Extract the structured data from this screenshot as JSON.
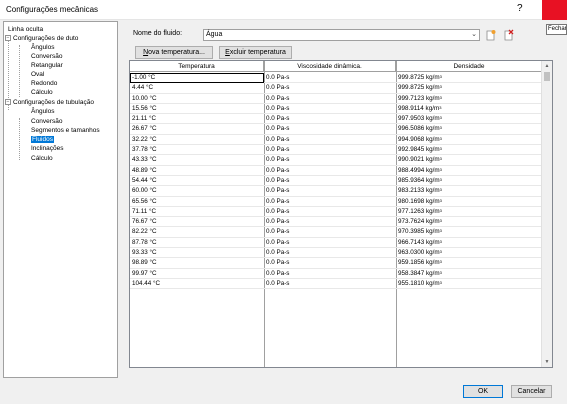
{
  "window": {
    "title": "Configurações mecânicas",
    "help_glyph": "?",
    "close_tooltip": "Fechar"
  },
  "tree": {
    "items": [
      {
        "label": "Linha oculta"
      },
      {
        "label": "Configurações de duto",
        "toggle": "−"
      },
      {
        "label": "Ângulos"
      },
      {
        "label": "Conversão"
      },
      {
        "label": "Retangular"
      },
      {
        "label": "Oval"
      },
      {
        "label": "Redondo"
      },
      {
        "label": "Cálculo"
      },
      {
        "label": "Configurações de tubulação",
        "toggle": "−"
      },
      {
        "label": "Ângulos"
      },
      {
        "label": "Conversão"
      },
      {
        "label": "Segmentos e tamanhos"
      },
      {
        "label": "Fluidos",
        "selected": true
      },
      {
        "label": "Inclinações"
      },
      {
        "label": "Cálculo"
      }
    ]
  },
  "fluid": {
    "label": "Nome do fluido:",
    "selected": "Água"
  },
  "buttons": {
    "new_temp_prefix": "N",
    "new_temp_rest": "ova temperatura...",
    "delete_temp_prefix": "E",
    "delete_temp_rest": "xcluir temperatura",
    "ok": "OK",
    "cancel": "Cancelar"
  },
  "table": {
    "headers": [
      "Temperatura",
      "Viscosidade dinâmica.",
      "Densidade"
    ],
    "density_unit": "kg/m",
    "density_exp": "3",
    "rows": [
      {
        "temp": "-1.00 °C",
        "visc": "0.0 Pa-s",
        "dens": "999.8725"
      },
      {
        "temp": "4.44 °C",
        "visc": "0.0 Pa-s",
        "dens": "999.8725"
      },
      {
        "temp": "10.00 °C",
        "visc": "0.0 Pa-s",
        "dens": "999.7123"
      },
      {
        "temp": "15.56 °C",
        "visc": "0.0 Pa-s",
        "dens": "998.9114"
      },
      {
        "temp": "21.11 °C",
        "visc": "0.0 Pa-s",
        "dens": "997.9503"
      },
      {
        "temp": "26.67 °C",
        "visc": "0.0 Pa-s",
        "dens": "996.5086"
      },
      {
        "temp": "32.22 °C",
        "visc": "0.0 Pa-s",
        "dens": "994.9068"
      },
      {
        "temp": "37.78 °C",
        "visc": "0.0 Pa-s",
        "dens": "992.9845"
      },
      {
        "temp": "43.33 °C",
        "visc": "0.0 Pa-s",
        "dens": "990.9021"
      },
      {
        "temp": "48.89 °C",
        "visc": "0.0 Pa-s",
        "dens": "988.4994"
      },
      {
        "temp": "54.44 °C",
        "visc": "0.0 Pa-s",
        "dens": "985.9364"
      },
      {
        "temp": "60.00 °C",
        "visc": "0.0 Pa-s",
        "dens": "983.2133"
      },
      {
        "temp": "65.56 °C",
        "visc": "0.0 Pa-s",
        "dens": "980.1698"
      },
      {
        "temp": "71.11 °C",
        "visc": "0.0 Pa-s",
        "dens": "977.1263"
      },
      {
        "temp": "76.67 °C",
        "visc": "0.0 Pa-s",
        "dens": "973.7624"
      },
      {
        "temp": "82.22 °C",
        "visc": "0.0 Pa-s",
        "dens": "970.3985"
      },
      {
        "temp": "87.78 °C",
        "visc": "0.0 Pa-s",
        "dens": "966.7143"
      },
      {
        "temp": "93.33 °C",
        "visc": "0.0 Pa-s",
        "dens": "963.0300"
      },
      {
        "temp": "98.89 °C",
        "visc": "0.0 Pa-s",
        "dens": "959.1856"
      },
      {
        "temp": "99.97 °C",
        "visc": "0.0 Pa-s",
        "dens": "958.3847"
      },
      {
        "temp": "104.44 °C",
        "visc": "0.0 Pa-s",
        "dens": "955.1810"
      }
    ]
  },
  "colors": {
    "close_button": "#e81123",
    "selection": "#0078d7"
  }
}
